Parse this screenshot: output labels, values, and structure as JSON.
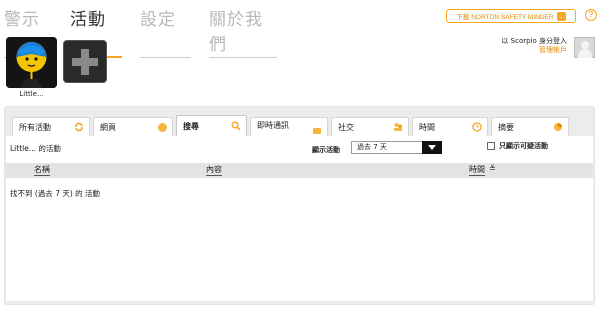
{
  "nav": {
    "tabs": [
      {
        "label": "警示"
      },
      {
        "label": "活動"
      },
      {
        "label": "設定"
      },
      {
        "label": "關於我們"
      }
    ]
  },
  "header": {
    "download_label": "下載 NORTON SAFETY MINDER",
    "help_label": "?",
    "login_text": "以 Scorpio 身分登入",
    "manage_account": "管理帳戶"
  },
  "children": [
    {
      "name": "Little..."
    }
  ],
  "activity_tabs": [
    {
      "label": "所有活動",
      "icon": "refresh-icon"
    },
    {
      "label": "網頁",
      "icon": "web-icon"
    },
    {
      "label": "搜尋",
      "icon": "search-icon"
    },
    {
      "label": "即時通訊",
      "icon": "chat-icon"
    },
    {
      "label": "社交",
      "icon": "social-icon"
    },
    {
      "label": "時間",
      "icon": "clock-icon"
    },
    {
      "label": "摘要",
      "icon": "summary-icon"
    }
  ],
  "activity": {
    "title": "Little... 的活動",
    "show_label": "顯示活動",
    "range_value": "過去 7 天",
    "suspicious_label": "只顯示可疑活動",
    "columns": {
      "name": "名稱",
      "content": "內容",
      "time": "時間"
    },
    "empty_message": "找不到 (過去 7 天) 的 活動"
  },
  "colors": {
    "accent": "#f5a623",
    "panel_bg": "#ececec",
    "header_bg": "#e3e3e3"
  }
}
